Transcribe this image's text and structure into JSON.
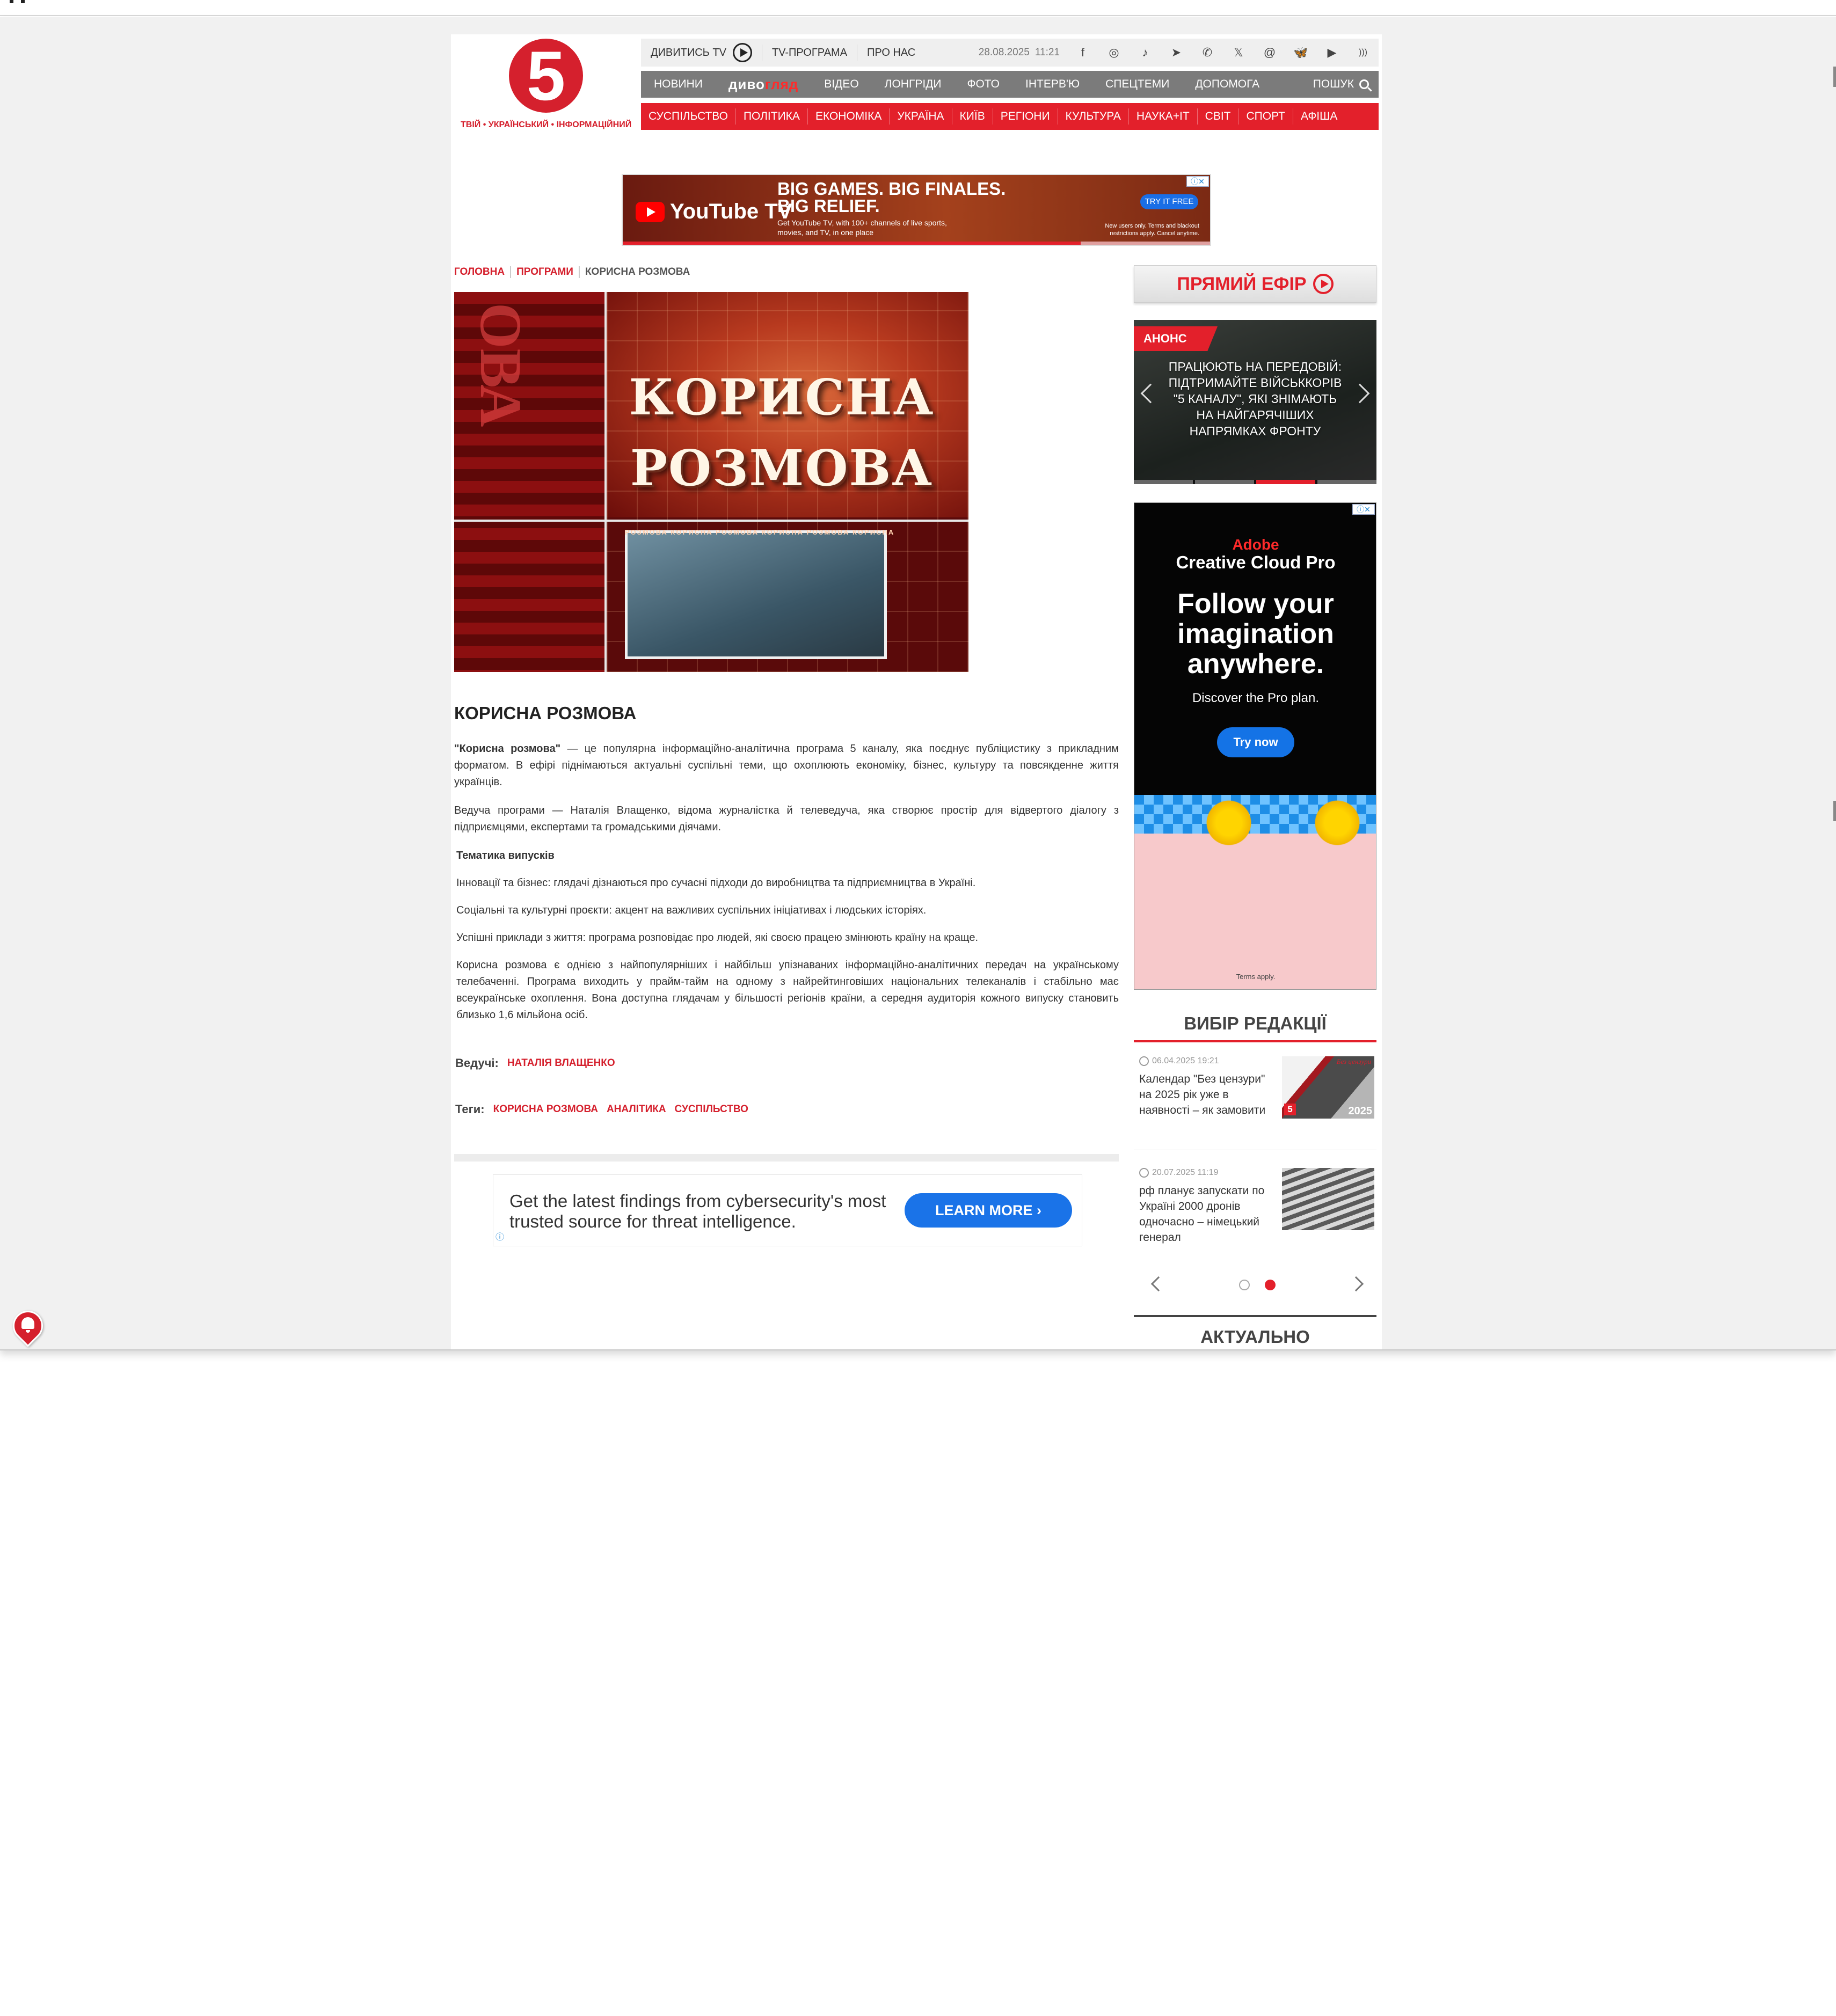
{
  "header": {
    "logo_digit": "5",
    "logo_tagline": "ТВІЙ • УКРАЇНСЬКИЙ • ІНФОРМАЦІЙНИЙ",
    "watch_tv": "ДИВИТИСЬ TV",
    "tv_program": "TV-ПРОГРАМА",
    "about": "ПРО НАС",
    "date": "28.08.2025",
    "time": "11:21",
    "social": [
      {
        "icon": "facebook-icon",
        "glyph": "f"
      },
      {
        "icon": "instagram-icon",
        "glyph": "◎"
      },
      {
        "icon": "tiktok-icon",
        "glyph": "♪"
      },
      {
        "icon": "telegram-icon",
        "glyph": "➤"
      },
      {
        "icon": "whatsapp-icon",
        "glyph": "✆"
      },
      {
        "icon": "x-icon",
        "glyph": "𝕏"
      },
      {
        "icon": "threads-icon",
        "glyph": "@"
      },
      {
        "icon": "bluesky-icon",
        "glyph": "🦋"
      },
      {
        "icon": "youtube-icon",
        "glyph": "▶"
      },
      {
        "icon": "rss-icon",
        "glyph": ")))"
      }
    ],
    "main_nav": {
      "news": "НОВИНИ",
      "divo_a": "диво",
      "divo_b": "гляд",
      "video": "ВІДЕО",
      "longreads": "ЛОНГРІДИ",
      "photo": "ФОТО",
      "interview": "ІНТЕРВ'Ю",
      "special": "СПЕЦТЕМИ",
      "help": "ДОПОМОГА",
      "search": "ПОШУК"
    },
    "categories": [
      "СУСПІЛЬСТВО",
      "ПОЛІТИКА",
      "ЕКОНОМІКА",
      "УКРАЇНА",
      "КИЇВ",
      "РЕГІОНИ",
      "КУЛЬТУРА",
      "НАУКА+IT",
      "СВІТ",
      "СПОРТ",
      "АФІША"
    ]
  },
  "ad_top": {
    "brand": "YouTube TV",
    "headline_1": "BIG GAMES. BIG FINALES.",
    "headline_2": "BIG RELIEF.",
    "sub": "Get YouTube TV, with 100+ channels of live sports, movies, and TV, in one place",
    "cta": "TRY IT FREE",
    "fine": "New users only. Terms and blackout restrictions apply. Cancel anytime.",
    "badge": "ⓘ✕",
    "progress": 0.78
  },
  "breadcrumbs": [
    "ГОЛОВНА",
    "ПРОГРАМИ",
    "КОРИСНА РОЗМОВА"
  ],
  "hero": {
    "title": "КОРИСНА РОЗМОВА",
    "vertical": "ОВА",
    "strip": "РОЗМОВА    КОРИСНА  РОЗМОВА    КОРИСНА  РОЗМОВА    КОРИСНА"
  },
  "article": {
    "title": "КОРИСНА РОЗМОВА",
    "p1_bold": "\"Корисна розмова\"",
    "p1_rest": " — це популярна інформаційно-аналітична програма 5 каналу, яка поєднує публіцистику з прикладним форматом. В ефірі піднімаються актуальні суспільні теми, що охоплюють економіку, бізнес, культуру та повсякденне життя українців.",
    "p2": "Ведуча програми — Наталія Влащенко, відома журналістка й телеведуча, яка створює простір для відвертого діалогу з підприємцями, експертами та громадськими діячами.",
    "subheading": "Тематика випусків",
    "topic1": "Інновації та бізнес: глядачі дізнаються про сучасні підходи до виробництва та підприємництва в Україні.",
    "topic2": "Соціальні та культурні проєкти: акцент на важливих суспільних ініціативах і людських історіях.",
    "topic3": " Успішні приклади з життя: програма розповідає про людей, які своєю працею змінюють країну на краще.",
    "p3": "Корисна розмова є однією з найпопулярніших і найбільш упізнаваних інформаційно-аналітичних передач на українському телебаченні. Програма виходить у прайм-тайм на одному з найрейтинговіших національних телеканалів і стабільно має всеукраїнське охоплення. Вона доступна глядачам у більшості регіонів країни, а середня аудиторія кожного випуску становить близько 1,6 мільйона осіб.",
    "hosts_label": "Ведучі:",
    "host": "НАТАЛІЯ ВЛАЩЕНКО",
    "tags_label": "Теги:",
    "tags": [
      "КОРИСНА РОЗМОВА",
      "АНАЛІТИКА",
      "СУСПІЛЬСТВО"
    ]
  },
  "ad_bottom": {
    "text": "Get the latest findings from cybersecurity's most trusted source for threat intelligence.",
    "cta": "LEARN MORE",
    "info": "ⓘ"
  },
  "sidebar": {
    "live": "ПРЯМИЙ ЕФІР",
    "anons_badge": "АНОНС",
    "anons_text": "ПРАЦЮЮТЬ НА ПЕРЕДОВІЙ: ПІДТРИМАЙТЕ ВІЙСЬККОРІВ \"5 КАНАЛУ\", ЯКІ ЗНІМАЮТЬ НА НАЙГАРЯЧІШИХ НАПРЯМКАХ ФРОНТУ",
    "ad": {
      "brand": "Adobe",
      "product": "Creative Cloud Pro",
      "headline": "Follow your imagination anywhere.",
      "sub": "Discover the Pro plan.",
      "cta": "Try now",
      "terms": "Terms apply.",
      "badge": "ⓘ✕"
    },
    "editors_choice": "ВИБІР РЕДАКЦІЇ",
    "news": [
      {
        "time": "06.04.2025 19:21",
        "title": "Календар \"Без цензури\" на 2025 рік уже в наявності – як замовити",
        "thumb_label": "Без цензури",
        "thumb_year": "2025"
      },
      {
        "time": "20.07.2025 11:19",
        "title": "рф планує запускати по Україні 2000 дронів одночасно – німецький генерал"
      }
    ],
    "actual": "АКТУАЛЬНО"
  },
  "colors": {
    "brand_red": "#e3202b",
    "nav_grey": "#7b7b7b"
  }
}
